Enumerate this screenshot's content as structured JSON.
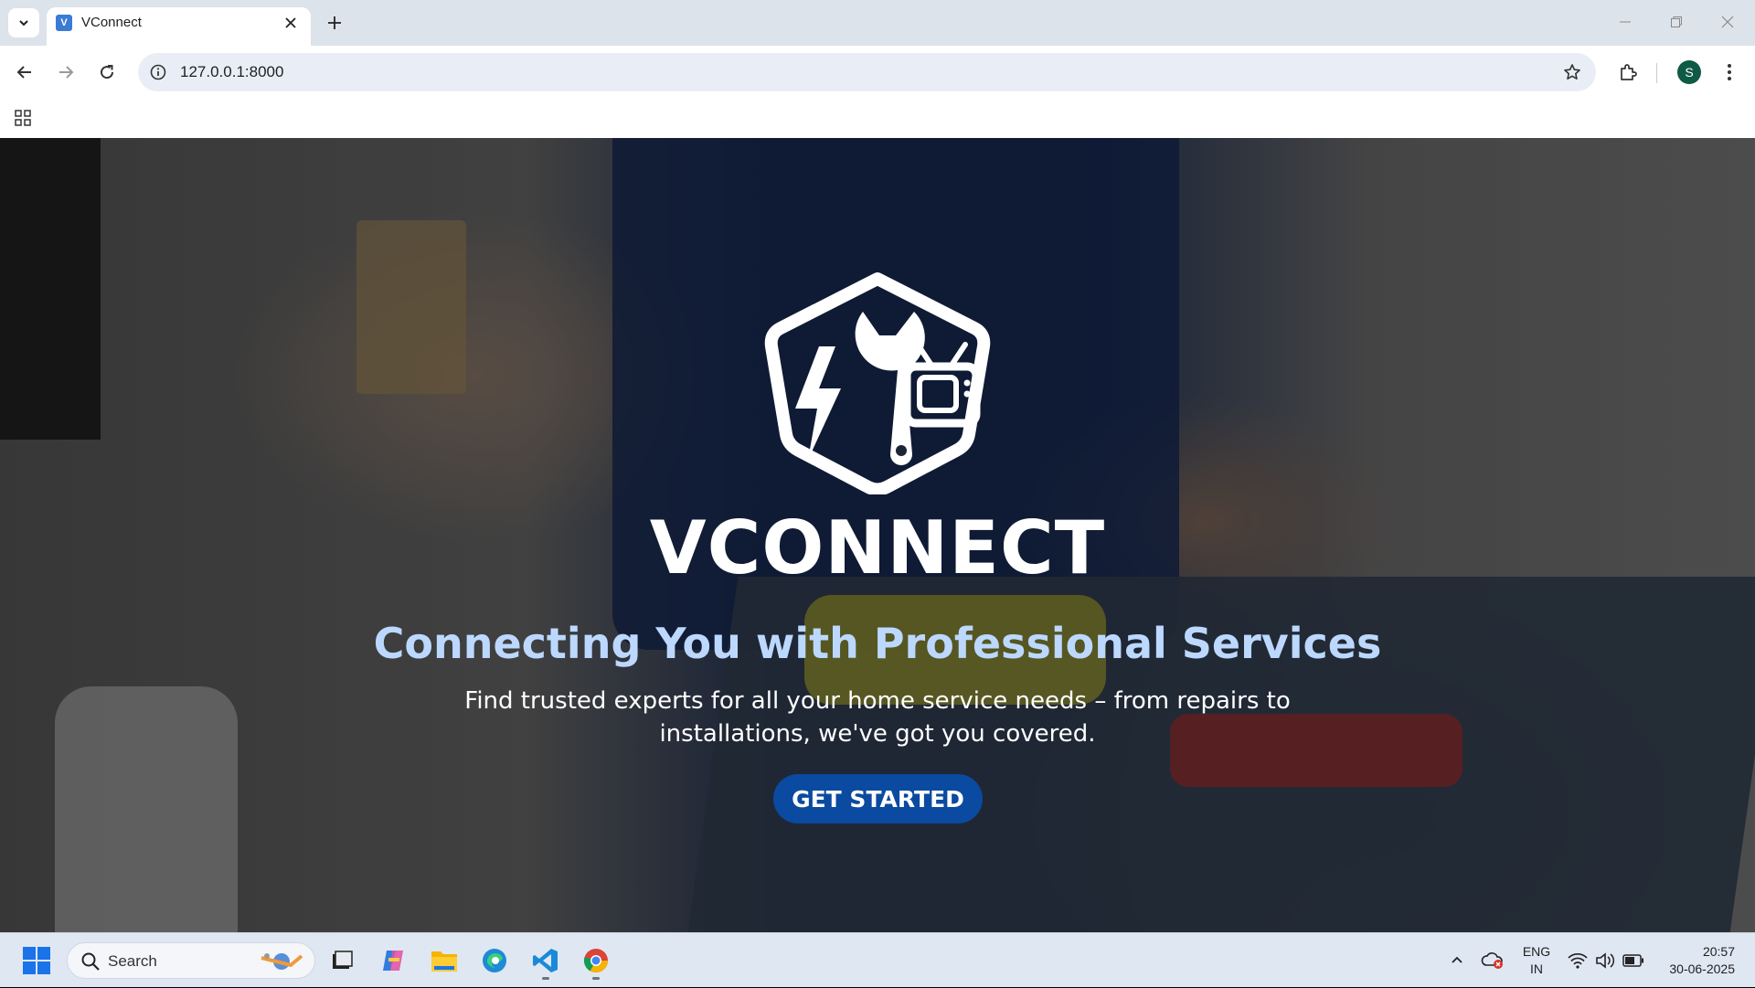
{
  "browser": {
    "tab_title": "VConnect",
    "favicon_letter": "V",
    "url": "127.0.0.1:8000",
    "profile_initial": "S"
  },
  "hero": {
    "brand": "VCONNECT",
    "headline": "Connecting You with Professional Services",
    "description": "Find trusted experts for all your home service needs – from repairs to installations, we've got you covered.",
    "cta_label": "GET STARTED"
  },
  "taskbar": {
    "search_label": "Search",
    "lang_line1": "ENG",
    "lang_line2": "IN",
    "time": "20:57",
    "date": "30-06-2025"
  },
  "colors": {
    "headline": "#bcd8ff",
    "cta": "#0a4aa0",
    "avatar": "#0f5a44"
  },
  "icons": [
    "chevron-down-icon",
    "close-icon",
    "plus-icon",
    "minimize-icon",
    "restore-icon",
    "back-icon",
    "forward-icon",
    "reload-icon",
    "info-icon",
    "star-icon",
    "extensions-icon",
    "more-icon",
    "apps-grid-icon",
    "windows-start-icon",
    "search-icon",
    "task-view-icon",
    "copilot-icon",
    "file-explorer-icon",
    "edge-icon",
    "vscode-icon",
    "chrome-icon",
    "chevron-up-icon",
    "cloud-icon",
    "wifi-icon",
    "volume-icon",
    "battery-icon"
  ]
}
